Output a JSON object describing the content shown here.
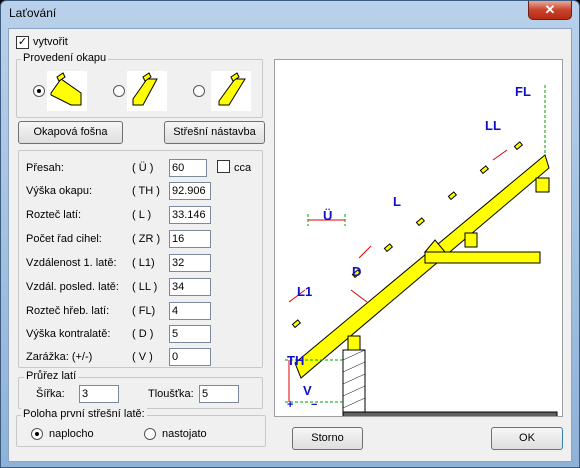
{
  "window": {
    "title": "Laťování",
    "close_glyph": "✕"
  },
  "create": {
    "checked": true,
    "label": "vytvořit",
    "check_glyph": "✓"
  },
  "eave_group": {
    "title": "Provedení okapu",
    "options": [
      {
        "selected": true
      },
      {
        "selected": false
      },
      {
        "selected": false
      }
    ]
  },
  "buttons": {
    "eave_board": "Okapová fošna",
    "roof_extension": "Střešní nástavba",
    "storno": "Storno",
    "ok": "OK"
  },
  "params": [
    {
      "label": "Přesah:",
      "code": "( Ü )",
      "value": "60"
    },
    {
      "label": "Výška okapu:",
      "code": "( TH )",
      "value": "92.906"
    },
    {
      "label": "Rozteč latí:",
      "code": "( L )",
      "value": "33.146"
    },
    {
      "label": "Počet řad cihel:",
      "code": "( ZR )",
      "value": "16"
    },
    {
      "label": "Vzdálenost 1. latě:",
      "code": "( L1)",
      "value": "32"
    },
    {
      "label": "Vzdál. posled. latě:",
      "code": "( LL )",
      "value": "34"
    },
    {
      "label": "Rozteč hřeb. latí:",
      "code": "( FL)",
      "value": "4"
    },
    {
      "label": "Výška kontralatě:",
      "code": "( D )",
      "value": "5"
    },
    {
      "label": "Zarážka: (+/-)",
      "code": "( V )",
      "value": "0"
    }
  ],
  "cca": {
    "label": "cca",
    "checked": false
  },
  "section": {
    "title": "Průřez latí",
    "width_label": "Šířka:",
    "width_value": "3",
    "thickness_label": "Tloušťka:",
    "thickness_value": "5"
  },
  "position": {
    "title": "Poloha první střešní latě:",
    "options": [
      {
        "label": "naplocho",
        "selected": true
      },
      {
        "label": "nastojato",
        "selected": false
      }
    ]
  },
  "diagram": {
    "labels": {
      "fl": "FL",
      "ll": "LL",
      "l": "L",
      "u": "Ü",
      "d": "D",
      "l1": "L1",
      "th": "TH",
      "v": "V",
      "plus": "+",
      "minus": "−"
    },
    "colors": {
      "beam": "#ffff00",
      "label": "#1010c8",
      "arrow": "#e00000",
      "green": "#00a000",
      "wall": "#606060"
    }
  }
}
